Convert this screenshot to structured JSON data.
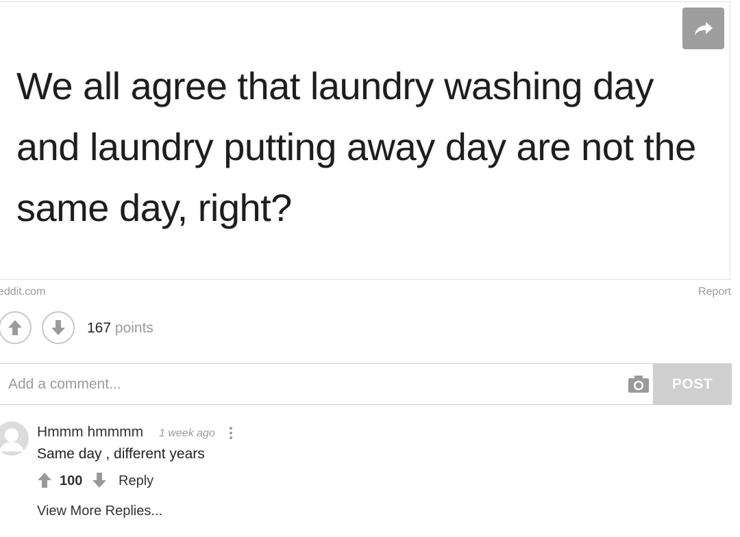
{
  "post": {
    "image_text": "We all agree that laundry washing day and laundry putting away day are not the same day, right?",
    "source": "eddit.com",
    "report_label": "Report",
    "score": "167",
    "score_unit": "points",
    "share_icon": "share-arrow-icon"
  },
  "comment_box": {
    "placeholder": "Add a comment...",
    "post_label": "POST",
    "camera_icon": "camera-icon"
  },
  "comments": [
    {
      "author": "Hmmm hmmmm",
      "timestamp": "1 week ago",
      "body": "Same day , different years",
      "score": "100",
      "reply_label": "Reply",
      "view_more_label": "View More Replies..."
    }
  ],
  "colors": {
    "accent_gray": "#9e9e9e",
    "post_button": "#cfcfcf",
    "muted_text": "#9a9a9a"
  }
}
